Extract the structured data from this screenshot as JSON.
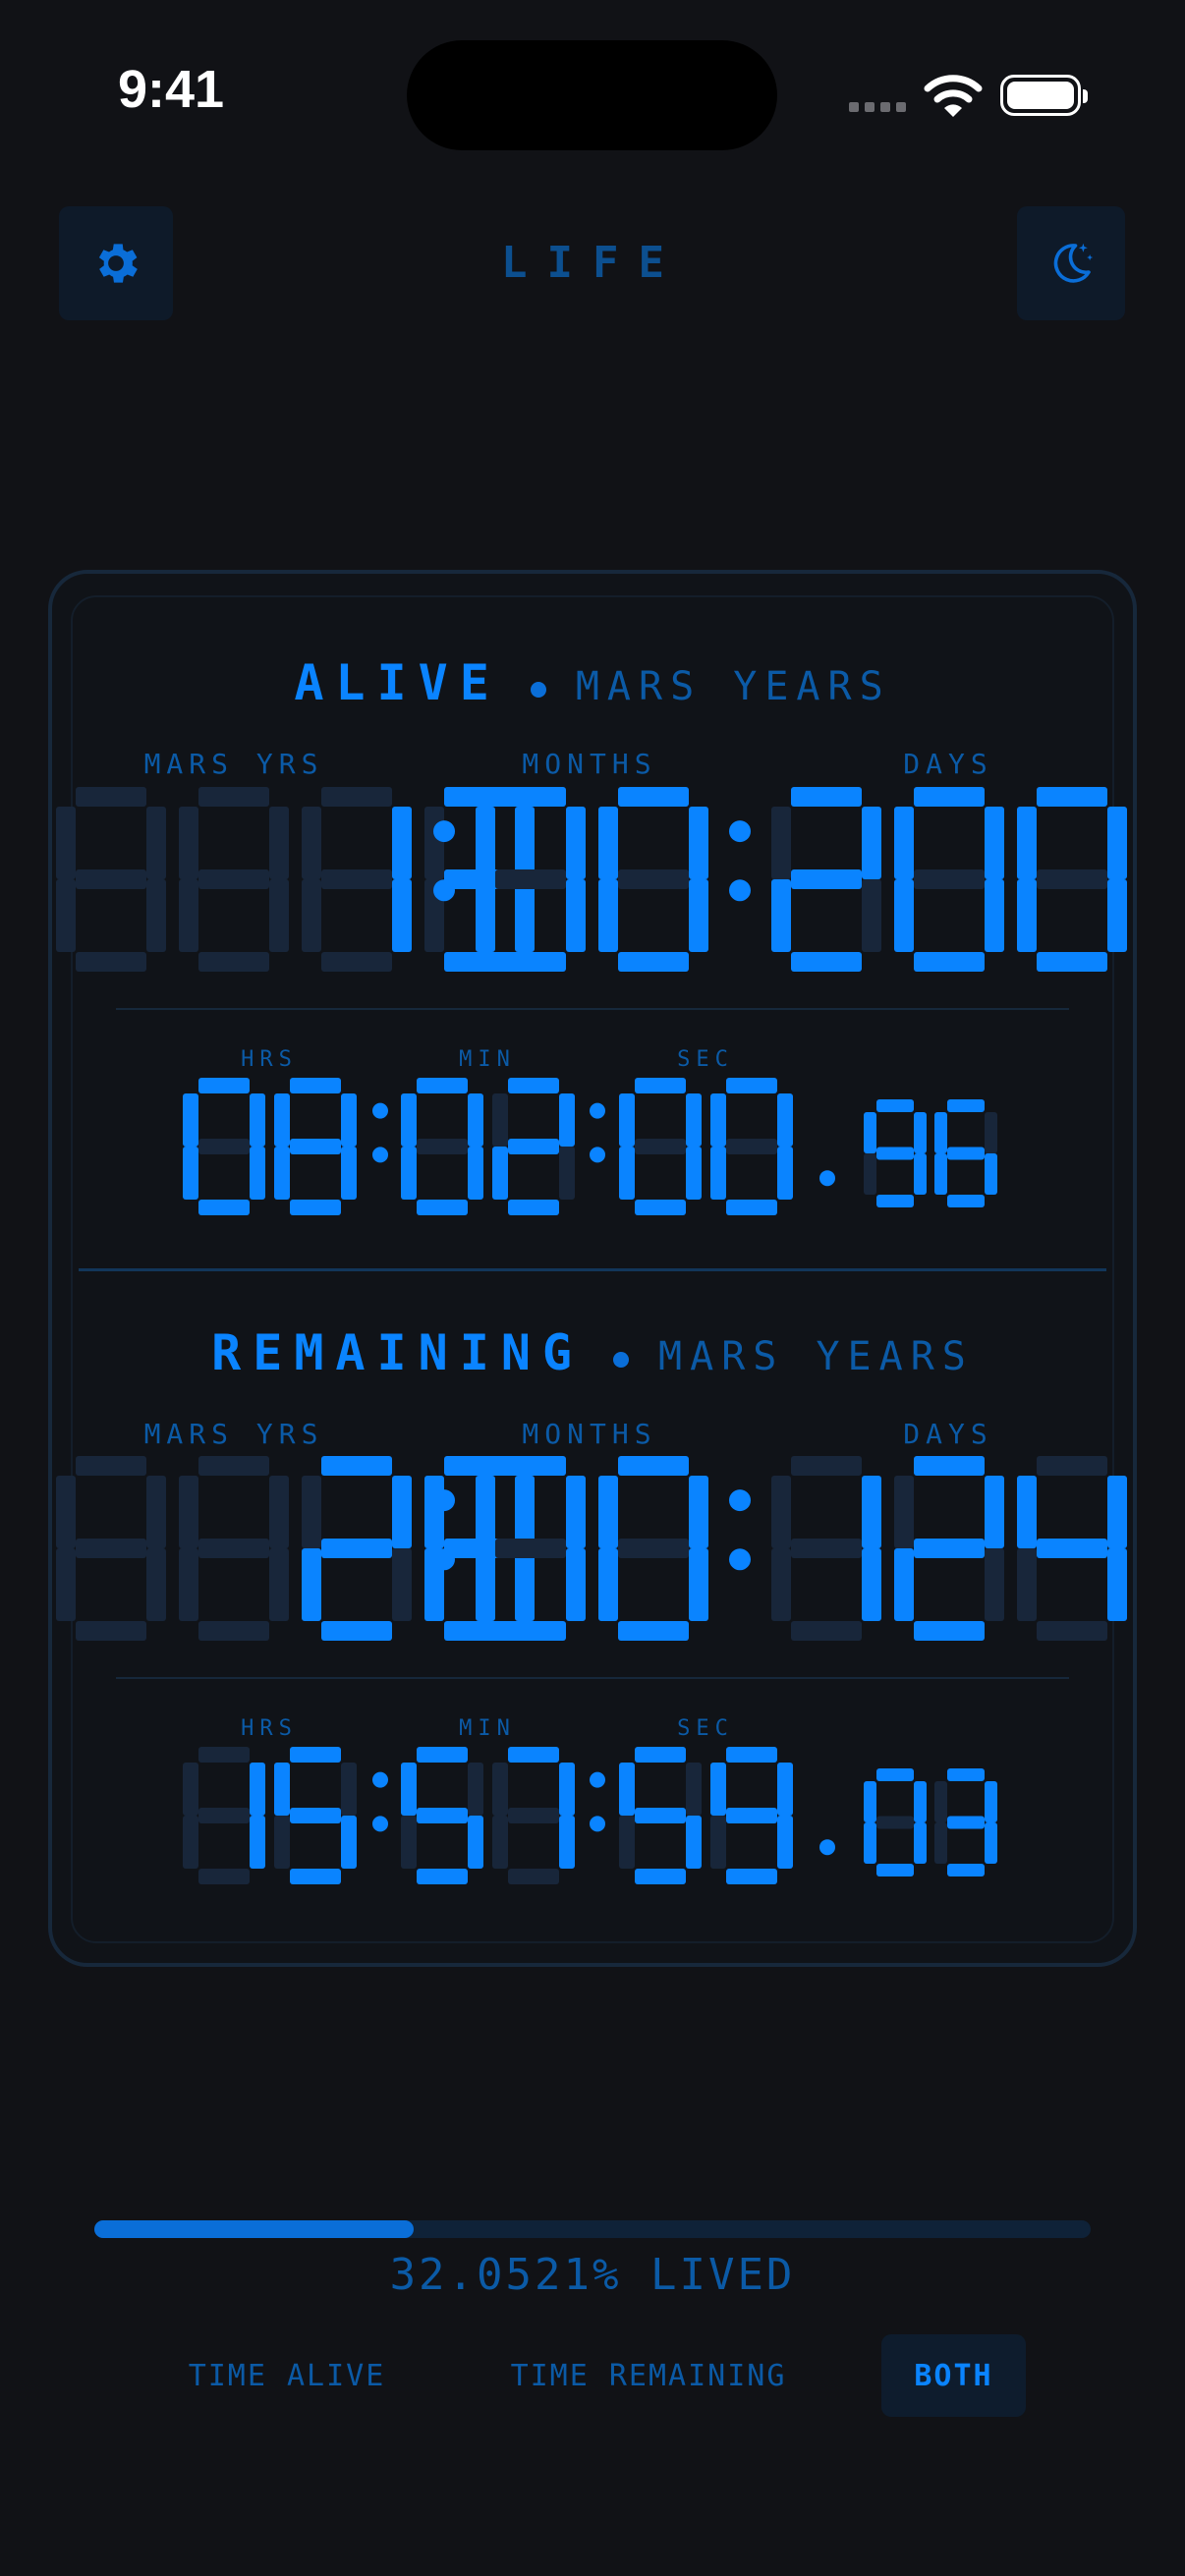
{
  "status_bar": {
    "time": "9:41"
  },
  "header": {
    "title": "LIFE",
    "settings_icon": "gear-icon",
    "theme_icon": "moon-stars-icon"
  },
  "alive": {
    "heading": "ALIVE",
    "unit": "MARS YEARS",
    "labels": {
      "years": "MARS YRS",
      "months": "MONTHS",
      "days": "DAYS"
    },
    "years": "13",
    "months": "00",
    "days": "200",
    "time_labels": {
      "hours": "HRS",
      "minutes": "MIN",
      "seconds": "SEC"
    },
    "hours": "08",
    "minutes": "02",
    "seconds": "00",
    "fraction": "96"
  },
  "remaining": {
    "heading": "REMAINING",
    "unit": "MARS YEARS",
    "labels": {
      "years": "MARS YRS",
      "months": "MONTHS",
      "days": "DAYS"
    },
    "years": "28",
    "months": "00",
    "days": "124",
    "time_labels": {
      "hours": "HRS",
      "minutes": "MIN",
      "seconds": "SEC"
    },
    "hours": "15",
    "minutes": "57",
    "seconds": "59",
    "fraction": "03"
  },
  "progress": {
    "percent": 32.0521,
    "text": "32.0521% LIVED"
  },
  "tabs": [
    {
      "label": "TIME ALIVE",
      "active": false
    },
    {
      "label": "TIME REMAINING",
      "active": false
    },
    {
      "label": "BOTH",
      "active": true
    }
  ],
  "colors": {
    "accent": "#0a84ff",
    "ghost": "#18263a",
    "background": "#111216"
  }
}
